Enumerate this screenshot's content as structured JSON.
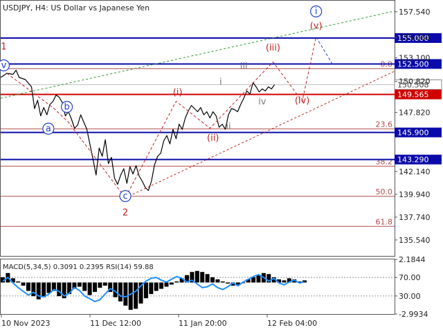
{
  "header": {
    "title": "USDJPY, H4:  US Dollar vs Japanese Yen"
  },
  "colors": {
    "price": "#000000",
    "level_blue": "#0a0aaa",
    "level_red": "#d00000",
    "fib_line": "#b04a4a",
    "wave_red": "#c02020",
    "wave_blue": "#2040d0",
    "wave_grey": "#7a7a7a",
    "trend_green": "#2a9a2a",
    "axis_text": "#222222",
    "macd_hist": "#000000",
    "rsi_line": "#1e90ff"
  },
  "chart_data": {
    "type": "line",
    "title": "USDJPY, H4:  US Dollar vs Japanese Yen",
    "ylim": [
      134.0,
      158.6
    ],
    "y_ticks": [
      "157.540",
      "155.060",
      "153.100",
      "150.820",
      "147.820",
      "142.140",
      "139.940",
      "137.740",
      "135.540"
    ],
    "x_ticks": [
      "10 Nov 2023",
      "11 Dec 12:00",
      "11 Jan 20:00",
      "12 Feb 04:00"
    ],
    "price_series": [
      [
        0,
        151.2
      ],
      [
        2,
        151.6
      ],
      [
        4,
        151.5
      ],
      [
        5,
        151.9
      ],
      [
        6,
        151.2
      ],
      [
        8,
        151.0
      ],
      [
        10,
        150.3
      ],
      [
        11,
        148.2
      ],
      [
        12,
        149.0
      ],
      [
        13,
        147.5
      ],
      [
        14,
        148.3
      ],
      [
        15,
        147.6
      ],
      [
        16,
        148.6
      ],
      [
        17,
        148.9
      ],
      [
        18,
        149.5
      ],
      [
        19,
        149.3
      ],
      [
        20,
        148.8
      ],
      [
        21,
        147.5
      ],
      [
        22,
        147.9
      ],
      [
        23,
        147.2
      ],
      [
        24,
        146.3
      ],
      [
        25,
        146.6
      ],
      [
        26,
        147.6
      ],
      [
        27,
        146.9
      ],
      [
        28,
        146.2
      ],
      [
        30,
        143.3
      ],
      [
        31,
        141.8
      ],
      [
        32,
        144.4
      ],
      [
        33,
        143.6
      ],
      [
        34,
        145.2
      ],
      [
        35,
        142.9
      ],
      [
        36,
        143.5
      ],
      [
        37,
        141.5
      ],
      [
        38,
        140.9
      ],
      [
        39,
        141.8
      ],
      [
        40,
        142.4
      ],
      [
        41,
        141.0
      ],
      [
        42,
        142.6
      ],
      [
        43,
        141.9
      ],
      [
        44,
        142.7
      ],
      [
        45,
        141.7
      ],
      [
        46,
        141.2
      ],
      [
        47,
        140.6
      ],
      [
        48,
        140.3
      ],
      [
        49,
        141.2
      ],
      [
        50,
        142.8
      ],
      [
        51,
        143.6
      ],
      [
        52,
        143.9
      ],
      [
        53,
        145.1
      ],
      [
        54,
        145.6
      ],
      [
        55,
        144.8
      ],
      [
        56,
        146.2
      ],
      [
        57,
        145.3
      ],
      [
        58,
        146.7
      ],
      [
        59,
        146.2
      ],
      [
        60,
        147.3
      ],
      [
        61,
        148.0
      ],
      [
        62,
        148.5
      ],
      [
        63,
        148.2
      ],
      [
        64,
        147.9
      ],
      [
        65,
        148.3
      ],
      [
        66,
        147.6
      ],
      [
        67,
        147.9
      ],
      [
        68,
        147.3
      ],
      [
        69,
        147.9
      ],
      [
        70,
        147.5
      ],
      [
        71,
        146.4
      ],
      [
        72,
        146.7
      ],
      [
        73,
        146.2
      ],
      [
        74,
        147.6
      ],
      [
        75,
        148.2
      ],
      [
        76,
        148.1
      ],
      [
        77,
        147.9
      ],
      [
        78,
        148.6
      ],
      [
        79,
        149.2
      ],
      [
        80,
        149.9
      ],
      [
        81,
        149.6
      ],
      [
        82,
        150.7
      ],
      [
        83,
        150.3
      ],
      [
        84,
        149.8
      ],
      [
        85,
        150.1
      ],
      [
        86,
        149.9
      ],
      [
        87,
        150.3
      ],
      [
        88,
        150.1
      ],
      [
        89,
        150.5
      ]
    ],
    "x_max": 128,
    "horizontal_levels": [
      {
        "label": "157.540",
        "value": 157.54,
        "kind": "none"
      },
      {
        "label": "155.000",
        "value": 155.0,
        "kind": "blue"
      },
      {
        "label": "152.500",
        "value": 152.5,
        "kind": "blue"
      },
      {
        "label": "150.508",
        "value": 150.508,
        "kind": "current"
      },
      {
        "label": "149.565",
        "value": 149.565,
        "kind": "red"
      },
      {
        "label": "145.900",
        "value": 145.9,
        "kind": "blue"
      },
      {
        "label": "143.290",
        "value": 143.29,
        "kind": "blue"
      }
    ],
    "fib_levels": [
      {
        "label": "0.0",
        "value": 152.05
      },
      {
        "label": "23.6",
        "value": 146.25
      },
      {
        "label": "38.2",
        "value": 142.65
      },
      {
        "label": "50.0",
        "value": 139.75
      },
      {
        "label": "61.8",
        "value": 136.85
      }
    ],
    "wave_labels": [
      {
        "text": "1",
        "x": 1,
        "y": 153.9,
        "color": "red",
        "circled": false
      },
      {
        "text": "v",
        "x": 1,
        "y": 152.1,
        "color": "blue",
        "circled": true
      },
      {
        "text": "a",
        "x": 15.5,
        "y": 146.0,
        "color": "blue",
        "circled": true
      },
      {
        "text": "b",
        "x": 21.5,
        "y": 148.1,
        "color": "blue",
        "circled": true
      },
      {
        "text": "c",
        "x": 40.5,
        "y": 139.5,
        "color": "blue",
        "circled": true
      },
      {
        "text": "2",
        "x": 40.5,
        "y": 137.9,
        "color": "red",
        "circled": false
      },
      {
        "text": "(i)",
        "x": 57.5,
        "y": 149.5,
        "color": "red",
        "circled": false
      },
      {
        "text": "(ii)",
        "x": 69,
        "y": 145.1,
        "color": "red",
        "circled": false
      },
      {
        "text": "(iii)",
        "x": 88.5,
        "y": 153.8,
        "color": "red",
        "circled": false
      },
      {
        "text": "(iv)",
        "x": 98,
        "y": 148.7,
        "color": "red",
        "circled": false
      },
      {
        "text": "(v)",
        "x": 102.5,
        "y": 155.9,
        "color": "red",
        "circled": false
      },
      {
        "text": "i",
        "x": 71.5,
        "y": 150.5,
        "color": "grey",
        "circled": false
      },
      {
        "text": "ii",
        "x": 74,
        "y": 146.2,
        "color": "grey",
        "circled": false
      },
      {
        "text": "iii",
        "x": 79,
        "y": 152.0,
        "color": "grey",
        "circled": false
      },
      {
        "text": "iv",
        "x": 85,
        "y": 148.6,
        "color": "grey",
        "circled": false
      },
      {
        "text": "i",
        "x": 102.5,
        "y": 157.3,
        "color": "blue",
        "circled": true
      }
    ],
    "wave_paths": [
      {
        "color": "red",
        "points": [
          [
            2,
            151.6
          ],
          [
            17,
            148.3
          ],
          [
            22,
            146.9
          ],
          [
            40.5,
            139.6
          ],
          [
            57,
            148.9
          ],
          [
            68,
            146.3
          ],
          [
            88.5,
            152.7
          ],
          [
            98,
            148.9
          ],
          [
            102.5,
            155.1
          ]
        ]
      },
      {
        "color": "blue",
        "points": [
          [
            102.5,
            155.1
          ],
          [
            108,
            152.4
          ]
        ]
      }
    ],
    "trend_lines": [
      {
        "color": "green",
        "points": [
          [
            0,
            149.2
          ],
          [
            128,
            157.6
          ]
        ]
      },
      {
        "color": "red",
        "points": [
          [
            40.5,
            139.6
          ],
          [
            128,
            151.8
          ]
        ]
      }
    ],
    "indicator": {
      "label": "MACD(5,34,5) 0.3091 0.2395 RSI(14) 59.88",
      "y_ticks": [
        "2.1844",
        "70.00",
        "30.00",
        "-2.9934"
      ],
      "ylim": [
        -3.0,
        2.2
      ],
      "macd_hist": [
        0.5,
        0.9,
        0.4,
        0.1,
        -0.3,
        -0.8,
        -1.3,
        -1.6,
        -1.4,
        -1.0,
        -0.8,
        -1.3,
        -1.5,
        -1.1,
        -0.6,
        -0.4,
        -0.8,
        -1.2,
        -0.9,
        -0.5,
        -0.3,
        -0.9,
        -1.4,
        -1.8,
        -2.2,
        -2.6,
        -2.5,
        -2.0,
        -1.5,
        -1.1,
        -0.8,
        -0.6,
        -0.4,
        -0.2,
        0.1,
        0.4,
        0.7,
        1.0,
        1.1,
        1.0,
        0.8,
        0.5,
        0.3,
        0.1,
        -0.1,
        -0.3,
        -0.2,
        0.0,
        0.3,
        0.5,
        0.7,
        0.9,
        0.8,
        0.5,
        0.3,
        0.2,
        0.4,
        0.3,
        0.1,
        0.2
      ],
      "rsi": [
        62,
        70,
        58,
        48,
        40,
        32,
        38,
        30,
        28,
        34,
        44,
        40,
        30,
        36,
        48,
        42,
        30,
        24,
        18,
        22,
        34,
        46,
        40,
        30,
        28,
        34,
        40,
        52,
        62,
        68,
        70,
        64,
        60,
        66,
        72,
        68,
        60,
        64,
        56,
        48,
        50,
        56,
        48,
        44,
        50,
        58,
        52,
        60,
        66,
        72,
        76,
        70,
        62,
        68,
        58,
        54,
        60,
        64,
        58,
        60
      ]
    }
  }
}
